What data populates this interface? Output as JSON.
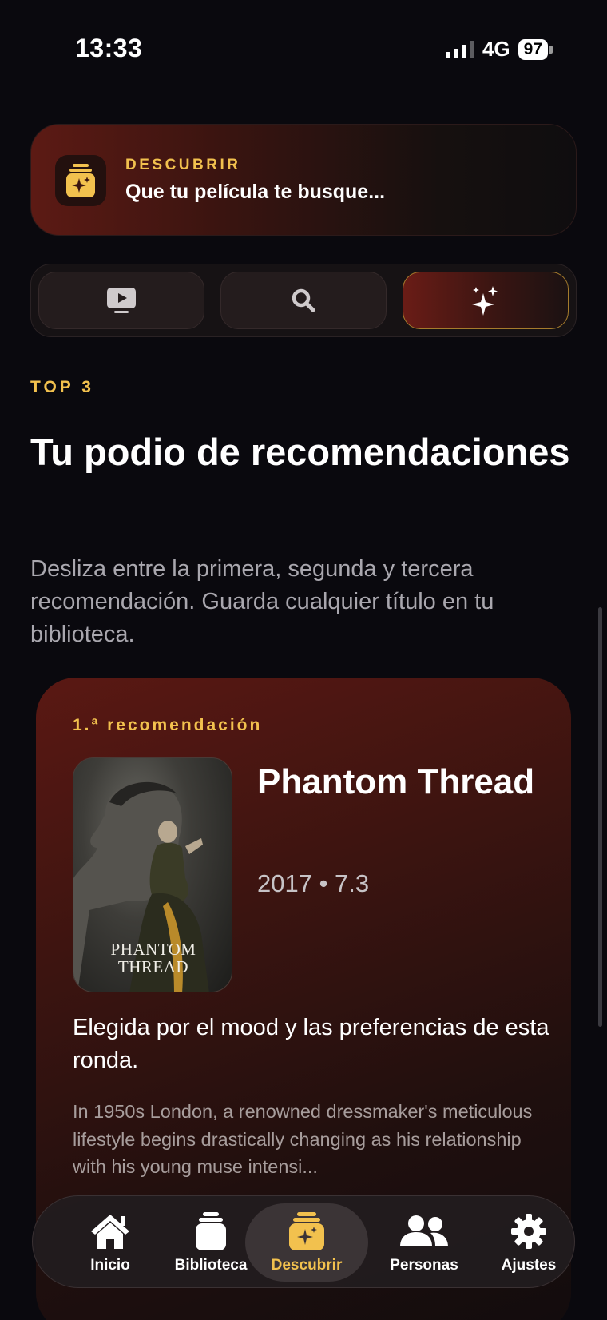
{
  "status_bar": {
    "time": "13:33",
    "network": "4G",
    "battery": "97"
  },
  "header": {
    "eyebrow": "DESCUBRIR",
    "title": "Que tu película te busque..."
  },
  "segments": [
    {
      "icon": "tv-play-icon",
      "selected": false
    },
    {
      "icon": "search-icon",
      "selected": false
    },
    {
      "icon": "sparkles-icon",
      "selected": true
    }
  ],
  "section": {
    "eyebrow": "TOP 3",
    "title": "Tu podio de recomendaciones",
    "description": "Desliza entre la primera, segunda y tercera recomendación. Guarda cualquier título en tu biblioteca."
  },
  "recommendation": {
    "label": "1.ª recomendación",
    "title": "Phantom Thread",
    "meta": "2017 • 7.3",
    "poster_text": "PHANTOM THREAD",
    "reason": "Elegida por el mood y las preferencias de esta ronda.",
    "synopsis": "In 1950s London, a renowned dressmaker's meticulous lifestyle begins drastically changing as his relationship with his young muse intensi..."
  },
  "tabs": [
    {
      "label": "Inicio",
      "icon": "house-icon",
      "active": false
    },
    {
      "label": "Biblioteca",
      "icon": "library-icon",
      "active": false
    },
    {
      "label": "Descubrir",
      "icon": "discover-icon",
      "active": true
    },
    {
      "label": "Personas",
      "icon": "people-icon",
      "active": false
    },
    {
      "label": "Ajustes",
      "icon": "gear-icon",
      "active": false
    }
  ],
  "colors": {
    "accent": "#f2c14e",
    "background": "#0a090e",
    "card": "#3c1410"
  }
}
